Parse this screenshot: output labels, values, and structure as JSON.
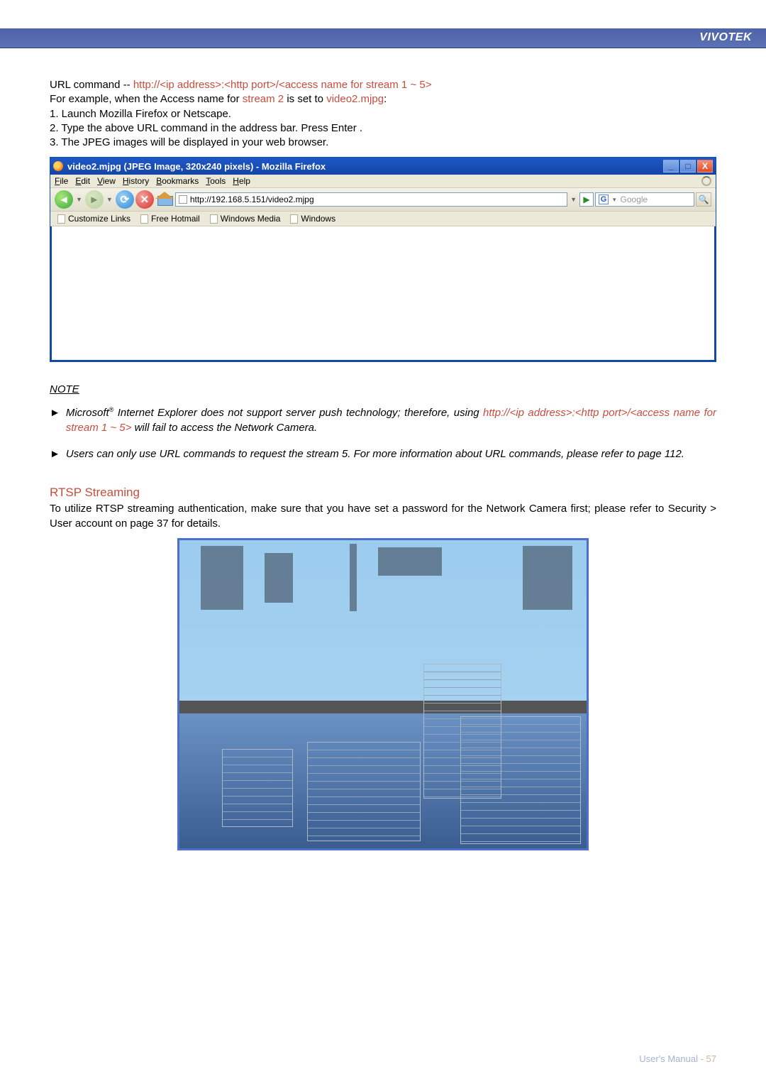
{
  "brand": "VIVOTEK",
  "url_cmd": {
    "pre": "URL command -- ",
    "link": "http://<ip address>:<http port>/<access name for stream 1 ~ 5>",
    "l2a": "For example, when the Access name for ",
    "l2b": "stream 2",
    "l2c": " is set to ",
    "l2d": "video2.mjpg",
    "l2e": ":",
    "step1": "1. Launch Mozilla Firefox or Netscape.",
    "step2": "2. Type the above URL command in the address bar. Press Enter .",
    "step3": "3. The JPEG images will be displayed in your web browser."
  },
  "ff": {
    "title": "video2.mjpg (JPEG Image, 320x240 pixels) - Mozilla Firefox",
    "menu": [
      "File",
      "Edit",
      "View",
      "History",
      "Bookmarks",
      "Tools",
      "Help"
    ],
    "url": "http://192.168.5.151/video2.mjpg",
    "search_placeholder": "Google",
    "bookmarks": [
      "Customize Links",
      "Free Hotmail",
      "Windows Media",
      "Windows"
    ],
    "win_min": "_",
    "win_max": "□",
    "win_close": "X",
    "go": "▶",
    "dd": "▼",
    "g": "G",
    "mag": "🔍"
  },
  "note": {
    "head": "NOTE",
    "arrow": "►",
    "n1a": "Microsoft",
    "n1sup": "®",
    "n1b": " Internet Explorer does not support server push technology; therefore, using ",
    "n1c": "http://<ip address>:<http port>/<access name for stream 1 ~ 5>",
    "n1d": " will fail to access the Network Camera.",
    "n2": "Users can only use URL commands to request the stream 5. For more information about URL commands, please refer to page 112."
  },
  "rtsp": {
    "head": "RTSP Streaming",
    "body": "To utilize RTSP streaming authentication, make sure that you have set a password for the Network Camera first; please refer to Security > User account on page 37 for details."
  },
  "footer": {
    "label": "User's Manual - ",
    "page": "57"
  }
}
